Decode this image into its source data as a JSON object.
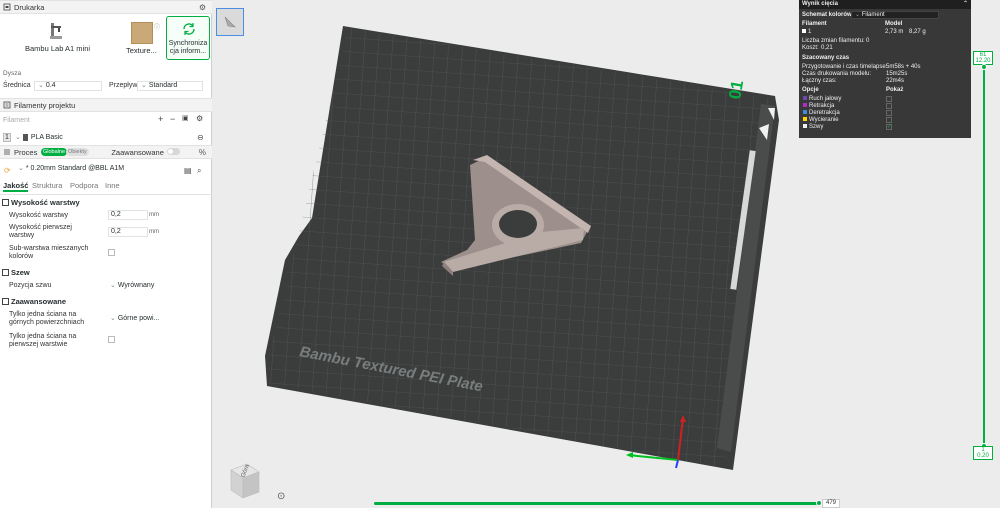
{
  "printer_section": {
    "title": "Drukarka"
  },
  "printer": {
    "name": "Bambu Lab A1 mini",
    "plate": "Texture...",
    "sync_label_1": "Synchroniza",
    "sync_label_2": "cja inform..."
  },
  "nozzle": {
    "section": "Dysza",
    "diameter_label": "Średnica",
    "diameter_value": "0.4",
    "flow_label": "Przepływ",
    "flow_value": "Standard"
  },
  "filaments_section": {
    "title": "Filamenty projektu",
    "placeholder": "Filament",
    "items": [
      {
        "index": "1",
        "name": "PLA Basic"
      }
    ]
  },
  "process_section": {
    "title": "Proces",
    "global_pill": "Globalne",
    "object_pill": "Obiekty",
    "advanced_label": "Zaawansowane",
    "preset": "* 0.20mm Standard @BBL A1M"
  },
  "tabs": [
    "Jakość",
    "Struktura",
    "Podpora",
    "Inne"
  ],
  "quality": {
    "layer_height_group": "Wysokość warstwy",
    "layer_height_label": "Wysokość warstwy",
    "layer_height_value": "0,2",
    "layer_height_unit": "mm",
    "first_layer_label_1": "Wysokość pierwszej",
    "first_layer_label_2": "warstwy",
    "first_layer_value": "0,2",
    "first_layer_unit": "mm",
    "sub_layer_label_1": "Sub-warstwa mieszanych",
    "sub_layer_label_2": "kolorów",
    "seam_group": "Szew",
    "seam_pos_label": "Pozycja szwu",
    "seam_pos_value": "Wyrównany",
    "advanced_group": "Zaawansowane",
    "top_wall_label_1": "Tylko jedna ściana na",
    "top_wall_label_2": "górnych powierzchniach",
    "top_wall_value": "Górne powi...",
    "first_wall_label_1": "Tylko jedna ściana na",
    "first_wall_label_2": "pierwszej warstwie"
  },
  "viewport": {
    "plate_text": "Bambu Textured PEI Plate",
    "plate_number": "01",
    "cube_label": "Góra"
  },
  "result": {
    "title": "Wynik cięcia",
    "color_scheme_label": "Schemat kolorów",
    "color_scheme_value": "Filament",
    "col_filament": "Filament",
    "col_model": "Model",
    "filament_index": "1",
    "filament_length": "2,73 m",
    "filament_weight": "8,27 g",
    "changes_label": "Liczba zmian filamentu:",
    "changes_value": "0",
    "cost_label": "Koszt:",
    "cost_value": "0,21",
    "time_section": "Szacowany czas",
    "prep_label": "Przygotowanie i czas timelapse:",
    "prep_value": "5m58s + 40s",
    "model_time_label": "Czas drukowania modelu:",
    "model_time_value": "15m25s",
    "total_label": "Łączny czas:",
    "total_value": "22m4s",
    "options_label": "Opcje",
    "show_label": "Pokaż",
    "options": [
      {
        "name": "Ruch jałowy",
        "color": "#6d4aa8"
      },
      {
        "name": "Retrakcja",
        "color": "#b42ac8"
      },
      {
        "name": "Deretrakcja",
        "color": "#3e8cd8"
      },
      {
        "name": "Wycieranie",
        "color": "#ffd400"
      },
      {
        "name": "Szwy",
        "color": "#f0f0f0"
      }
    ]
  },
  "layer_slider": {
    "top_label": "61",
    "top_value": "12.20",
    "bottom_label": "1",
    "bottom_value": "0.20"
  },
  "move_slider": {
    "value": "479"
  },
  "colors": {
    "accent": "#00ae42",
    "plate": "#3b3d3d",
    "model": "#b9aba6"
  }
}
